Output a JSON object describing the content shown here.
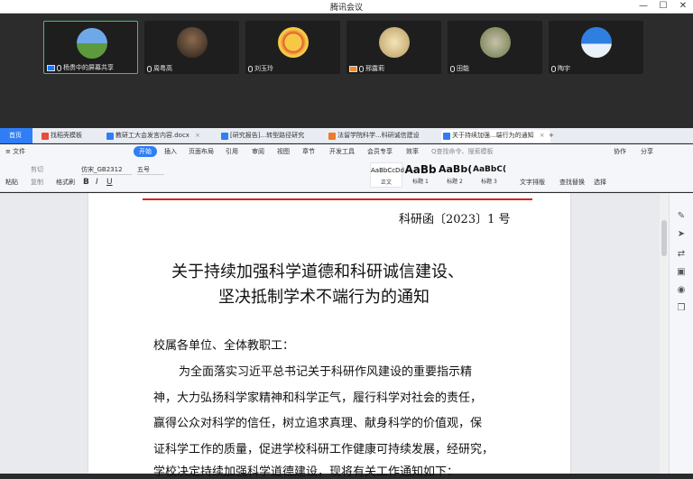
{
  "window": {
    "title": "腾讯会议",
    "minimize": "—",
    "maximize": "☐",
    "close": "✕"
  },
  "meeting": {
    "participants": [
      {
        "name": "杨贵中的屏幕共享",
        "avatar_color": "#4a8fd6",
        "active": true
      },
      {
        "name": "周粤高",
        "avatar_color": "#6a5a4a",
        "active": false
      },
      {
        "name": "刘玉玲",
        "avatar_color": "#e8b23a",
        "active": false
      },
      {
        "name": "邢露莉",
        "avatar_color": "#c9b48a",
        "active": false
      },
      {
        "name": "田能",
        "avatar_color": "#8a9a6a",
        "active": false
      },
      {
        "name": "陶宇",
        "avatar_color": "#3b86e0",
        "active": false
      }
    ]
  },
  "tabs": [
    {
      "label": "首页",
      "kind": "home"
    },
    {
      "label": "找稻壳模板",
      "color": "#e84c3d"
    },
    {
      "label": "教研工大会发言内容.docx",
      "color": "#2f7ef7"
    },
    {
      "label": "[研究报告]...转型路径研究",
      "color": "#2f7ef7"
    },
    {
      "label": "法留学院科学...科研诚信建设",
      "color": "#f07a2a"
    },
    {
      "label": "关于持续加强...端行为的通知",
      "color": "#2f7ef7",
      "current": true
    }
  ],
  "menu": {
    "file": "≡ 文件",
    "items": [
      "开始",
      "插入",
      "页面布局",
      "引用",
      "审阅",
      "视图",
      "章节",
      "开发工具",
      "会员专享",
      "效率"
    ],
    "search": "Q查找命令、搜索模板",
    "collab": "协作",
    "share": "分享"
  },
  "ribbon": {
    "paste": "粘贴",
    "cut": "剪切",
    "copy": "复制",
    "format_painter": "格式刷",
    "font": "仿宋_GB2312",
    "size": "五号",
    "styles": [
      {
        "preview": "AaBbCcDd",
        "name": "正文"
      },
      {
        "preview": "AaBb",
        "name": "标题 1"
      },
      {
        "preview": "AaBb(",
        "name": "标题 2"
      },
      {
        "preview": "AaBbC(",
        "name": "标题 3"
      }
    ],
    "text_layout": "文字排版",
    "find_replace": "查找替换",
    "select": "选择"
  },
  "document": {
    "doc_number": "科研函〔2023〕1 号",
    "title_line1": "关于持续加强科学道德和科研诚信建设、",
    "title_line2": "坚决抵制学术不端行为的通知",
    "salutation": "校属各单位、全体教职工：",
    "body_lines": [
      "为全面落实习近平总书记关于科研作风建设的重要指示精",
      "神，大力弘扬科学家精神和科学正气，履行科学对社会的责任，",
      "赢得公众对科学的信任，树立追求真理、献身科学的价值观，保",
      "证科学工作的质量，促进学校科研工作健康可持续发展，经研究，",
      "学校决定持续加强科学道德建设，现将有关工作通知如下："
    ]
  }
}
